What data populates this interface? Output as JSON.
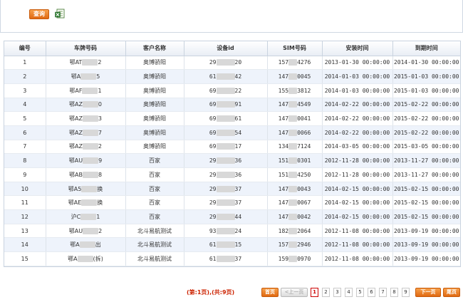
{
  "toolbar": {
    "query_label": "查询",
    "export_icon": "excel-export-icon"
  },
  "table": {
    "headers": [
      "编号",
      "车牌号码",
      "客户名称",
      "设备id",
      "SIM号码",
      "安装时间",
      "到期时间"
    ],
    "rows": [
      {
        "no": "1",
        "plate_a": "鄂AT",
        "plate_b": "2",
        "customer": "奥博骄阳",
        "dev_a": "29",
        "dev_b": "20",
        "sim_a": "157",
        "sim_b": "4276",
        "install": "2013-01-30 00:00:00",
        "expire": "2014-01-30 00:00:00"
      },
      {
        "no": "2",
        "plate_a": "鄂A",
        "plate_b": "5",
        "customer": "奥博骄阳",
        "dev_a": "61",
        "dev_b": "42",
        "sim_a": "147",
        "sim_b": "0045",
        "install": "2014-01-03 00:00:00",
        "expire": "2015-01-03 00:00:00"
      },
      {
        "no": "3",
        "plate_a": "鄂AF",
        "plate_b": "1",
        "customer": "奥博骄阳",
        "dev_a": "69",
        "dev_b": "22",
        "sim_a": "155",
        "sim_b": "3812",
        "install": "2014-01-03 00:00:00",
        "expire": "2015-01-03 00:00:00"
      },
      {
        "no": "4",
        "plate_a": "鄂AZ",
        "plate_b": "0",
        "customer": "奥博骄阳",
        "dev_a": "69",
        "dev_b": "91",
        "sim_a": "147",
        "sim_b": "4549",
        "install": "2014-02-22 00:00:00",
        "expire": "2015-02-22 00:00:00"
      },
      {
        "no": "5",
        "plate_a": "鄂AZ",
        "plate_b": "3",
        "customer": "奥博骄阳",
        "dev_a": "69",
        "dev_b": "61",
        "sim_a": "147",
        "sim_b": "0041",
        "install": "2014-02-22 00:00:00",
        "expire": "2015-02-22 00:00:00"
      },
      {
        "no": "6",
        "plate_a": "鄂AZ",
        "plate_b": "7",
        "customer": "奥博骄阳",
        "dev_a": "69",
        "dev_b": "54",
        "sim_a": "147",
        "sim_b": "0066",
        "install": "2014-02-22 00:00:00",
        "expire": "2015-02-22 00:00:00"
      },
      {
        "no": "7",
        "plate_a": "鄂AZ",
        "plate_b": "2",
        "customer": "奥博骄阳",
        "dev_a": "69",
        "dev_b": "17",
        "sim_a": "134",
        "sim_b": "7124",
        "install": "2014-03-05 00:00:00",
        "expire": "2015-03-05 00:00:00"
      },
      {
        "no": "8",
        "plate_a": "鄂AU",
        "plate_b": "9",
        "customer": "百家",
        "dev_a": "29",
        "dev_b": "36",
        "sim_a": "151",
        "sim_b": "0301",
        "install": "2012-11-28 00:00:00",
        "expire": "2013-11-27 00:00:00"
      },
      {
        "no": "9",
        "plate_a": "鄂AB",
        "plate_b": "8",
        "customer": "百家",
        "dev_a": "29",
        "dev_b": "36",
        "sim_a": "151",
        "sim_b": "4250",
        "install": "2012-11-28 00:00:00",
        "expire": "2013-11-27 00:00:00"
      },
      {
        "no": "10",
        "plate_a": "鄂A5",
        "plate_b": "换",
        "customer": "百家",
        "dev_a": "29",
        "dev_b": "37",
        "sim_a": "147",
        "sim_b": "0043",
        "install": "2014-02-15 00:00:00",
        "expire": "2015-02-15 00:00:00"
      },
      {
        "no": "11",
        "plate_a": "鄂AE",
        "plate_b": "换",
        "customer": "百家",
        "dev_a": "29",
        "dev_b": "37",
        "sim_a": "147",
        "sim_b": "0067",
        "install": "2014-02-15 00:00:00",
        "expire": "2015-02-15 00:00:00"
      },
      {
        "no": "12",
        "plate_a": "沪C",
        "plate_b": "1",
        "customer": "百家",
        "dev_a": "29",
        "dev_b": "44",
        "sim_a": "147",
        "sim_b": "0042",
        "install": "2014-02-15 00:00:00",
        "expire": "2015-02-15 00:00:00"
      },
      {
        "no": "13",
        "plate_a": "鄂AU",
        "plate_b": "2",
        "customer": "北斗易航测试",
        "dev_a": "93",
        "dev_b": "24",
        "sim_a": "182",
        "sim_b": "2064",
        "install": "2012-11-08 00:00:00",
        "expire": "2013-09-19 00:00:00"
      },
      {
        "no": "14",
        "plate_a": "鄂A",
        "plate_b": "出",
        "customer": "北斗易航测试",
        "dev_a": "61",
        "dev_b": "15",
        "sim_a": "157",
        "sim_b": "2946",
        "install": "2012-11-08 00:00:00",
        "expire": "2013-09-19 00:00:00"
      },
      {
        "no": "15",
        "plate_a": "鄂A",
        "plate_b": "(拆)",
        "customer": "北斗易航测试",
        "dev_a": "61",
        "dev_b": "37",
        "sim_a": "159",
        "sim_b": "0970",
        "install": "2012-11-08 00:00:00",
        "expire": "2013-09-19 00:00:00"
      }
    ]
  },
  "pager": {
    "info": "(第:1页),(共:9页)",
    "first": "首页",
    "prev": "<上一页",
    "pages": [
      "1",
      "2",
      "3",
      "4",
      "5",
      "6",
      "7",
      "8",
      "9"
    ],
    "current": "1",
    "next": "下一页",
    "last": "尾页"
  }
}
